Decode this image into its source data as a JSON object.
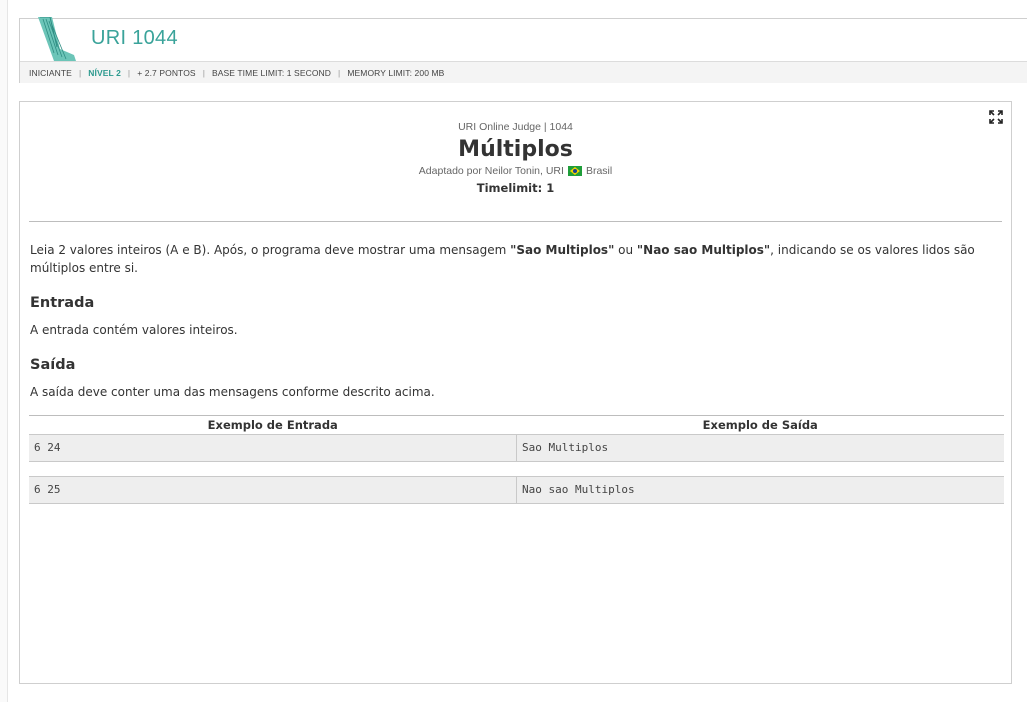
{
  "header": {
    "problem_code": "URI 1044",
    "meta": {
      "category": "INICIANTE",
      "level": "NÍVEL 2",
      "points": "+ 2.7 PONTOS",
      "time_limit": "BASE TIME LIMIT: 1 SECOND",
      "memory_limit": "MEMORY LIMIT: 200 MB"
    }
  },
  "problem": {
    "judge_line": "URI Online Judge | 1044",
    "title": "Múltiplos",
    "author_prefix": "Adaptado por Neilor Tonin, URI",
    "author_country": "Brasil",
    "timelimit": "Timelimit: 1",
    "description_pre": "Leia 2 valores inteiros (A e B). Após, o programa deve mostrar uma mensagem ",
    "description_bold1": "\"Sao Multiplos\"",
    "description_mid": " ou ",
    "description_bold2": "\"Nao sao Multiplos\"",
    "description_post": ", indicando se os valores lidos são múltiplos entre si.",
    "input_heading": "Entrada",
    "input_text": "A entrada contém valores inteiros.",
    "output_heading": "Saída",
    "output_text": "A saída deve conter uma das mensagens conforme descrito acima."
  },
  "examples": {
    "input_header": "Exemplo de Entrada",
    "output_header": "Exemplo de Saída",
    "rows": [
      {
        "input": "6 24",
        "output": "Sao Multiplos"
      },
      {
        "input": "6 25",
        "output": "Nao sao Multiplos"
      }
    ]
  },
  "icons": {
    "logo": "uri-logo-icon",
    "expand": "expand-icon",
    "flag": "brazil-flag-icon"
  },
  "colors": {
    "accent": "#3aa39a",
    "level": "#2d9a8f"
  }
}
